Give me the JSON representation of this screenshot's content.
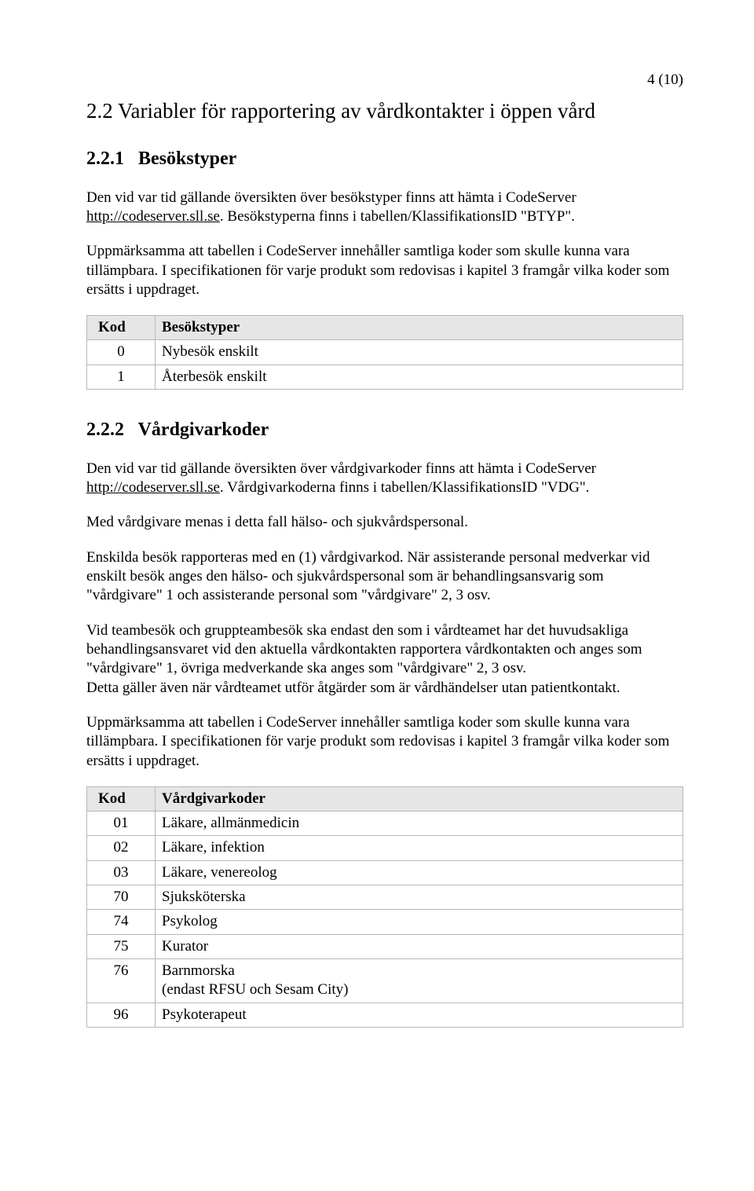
{
  "page_number": "4 (10)",
  "h2": "2.2  Variabler för rapportering av vårdkontakter i öppen vård",
  "sec221": {
    "num": "2.2.1",
    "title": "Besökstyper",
    "p1a": "Den vid var tid gällande översikten över besökstyper finns att hämta i CodeServer ",
    "p1_link": "http://codeserver.sll.se",
    "p1b": ". Besökstyperna finns i tabellen/KlassifikationsID \"BTYP\".",
    "p2": "Uppmärksamma att tabellen i CodeServer innehåller samtliga koder som skulle kunna vara tillämpbara. I specifikationen för varje produkt som redovisas i kapitel 3 framgår vilka koder som ersätts i uppdraget.",
    "table": {
      "h1": "Kod",
      "h2": "Besökstyper",
      "rows": [
        {
          "kod": "0",
          "text": "Nybesök enskilt"
        },
        {
          "kod": "1",
          "text": "Återbesök enskilt"
        }
      ]
    }
  },
  "sec222": {
    "num": "2.2.2",
    "title": "Vårdgivarkoder",
    "p1a": "Den vid var tid gällande översikten över vårdgivarkoder finns att hämta i CodeServer ",
    "p1_link": "http://codeserver.sll.se",
    "p1b": ". Vårdgivarkoderna finns i tabellen/KlassifikationsID \"VDG\".",
    "p2": "Med vårdgivare menas i detta fall hälso- och sjukvårdspersonal.",
    "p3": "Enskilda besök rapporteras med en (1) vårdgivarkod. När assisterande personal medverkar vid enskilt besök anges den hälso- och sjukvårdspersonal som är behandlingsansvarig som \"vårdgivare\" 1 och assisterande personal som \"vårdgivare\" 2, 3 osv.",
    "p4": "Vid teambesök och gruppteambesök ska endast den som i vårdteamet har det huvudsakliga behandlingsansvaret vid den aktuella vårdkontakten rapportera vårdkontakten och anges som \"vårdgivare\" 1, övriga medverkande ska anges som \"vårdgivare\" 2, 3 osv.",
    "p5": "Detta gäller även när vårdteamet utför åtgärder som är vårdhändelser utan patientkontakt.",
    "p6": "Uppmärksamma att tabellen i CodeServer innehåller samtliga koder som skulle kunna vara tillämpbara. I specifikationen för varje produkt som redovisas i kapitel 3 framgår vilka koder som ersätts i uppdraget.",
    "table": {
      "h1": "Kod",
      "h2": "Vårdgivarkoder",
      "rows": [
        {
          "kod": "01",
          "text": "Läkare, allmänmedicin"
        },
        {
          "kod": "02",
          "text": "Läkare, infektion"
        },
        {
          "kod": "03",
          "text": "Läkare, venereolog"
        },
        {
          "kod": "70",
          "text": "Sjuksköterska"
        },
        {
          "kod": "74",
          "text": "Psykolog"
        },
        {
          "kod": "75",
          "text": "Kurator"
        },
        {
          "kod": "76",
          "text": "Barnmorska",
          "sub": "(endast RFSU och Sesam City)"
        },
        {
          "kod": "96",
          "text": "Psykoterapeut"
        }
      ]
    }
  }
}
